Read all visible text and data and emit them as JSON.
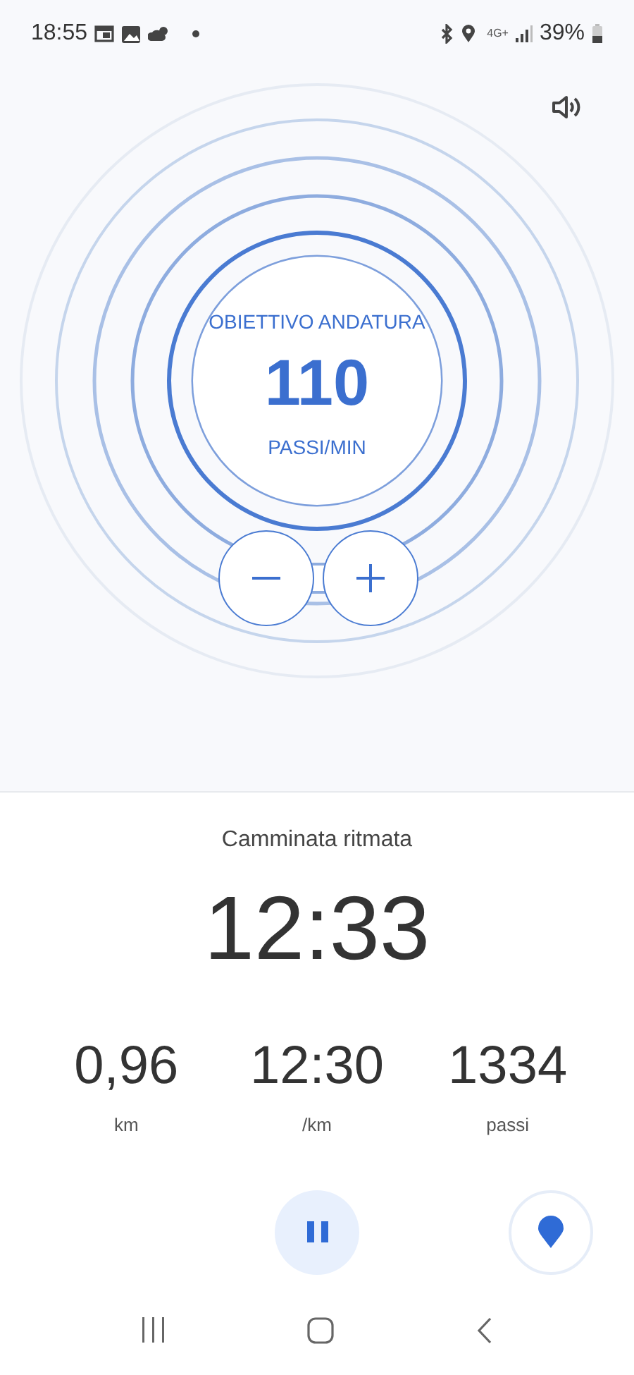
{
  "status_bar": {
    "time": "18:55",
    "network": "4G+",
    "battery": "39%"
  },
  "pace_goal": {
    "label": "OBIETTIVO ANDATURA",
    "value": "110",
    "unit": "PASSI/MIN"
  },
  "workout": {
    "title": "Camminata ritmata",
    "elapsed": "12:33",
    "stats": [
      {
        "value": "0,96",
        "unit": "km"
      },
      {
        "value": "12:30",
        "unit": "/km"
      },
      {
        "value": "1334",
        "unit": "passi"
      }
    ]
  }
}
